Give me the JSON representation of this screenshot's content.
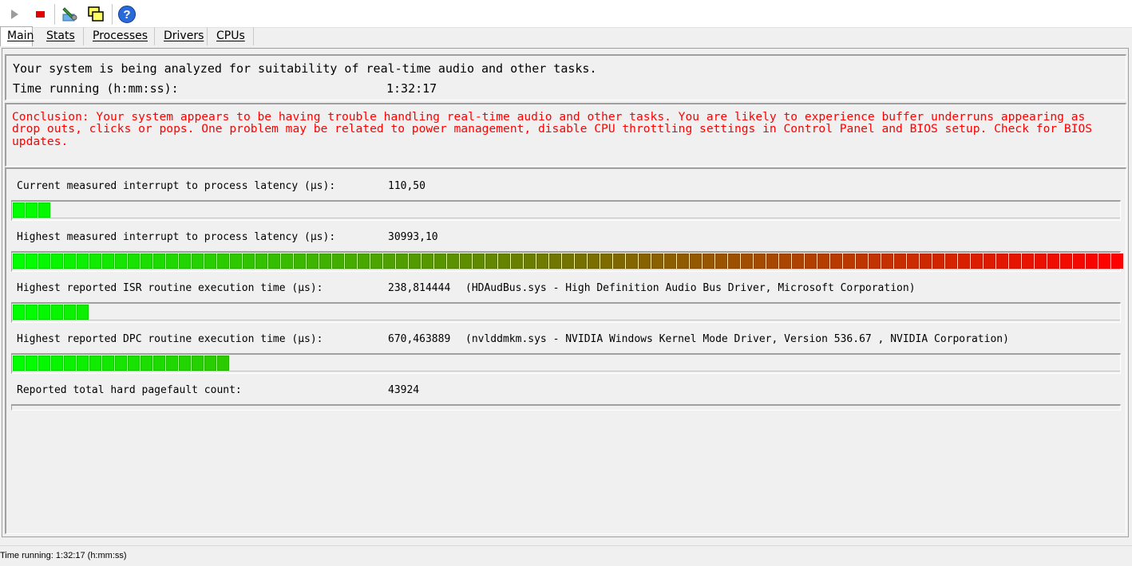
{
  "toolbar": {
    "buttons": [
      "play-icon",
      "stop-icon",
      "wrench-icon",
      "windows-icon",
      "help-icon"
    ]
  },
  "tabs": [
    {
      "label": "Main",
      "active": true
    },
    {
      "label": "Stats",
      "active": false
    },
    {
      "label": "Processes",
      "active": false
    },
    {
      "label": "Drivers",
      "active": false
    },
    {
      "label": "CPUs",
      "active": false
    }
  ],
  "summary": {
    "analyzing_text": "Your system is being analyzed for suitability of real-time audio and other tasks.",
    "time_running_label": "Time running (h:mm:ss):",
    "time_running_value": "1:32:17"
  },
  "conclusion": {
    "text": "Conclusion: Your system appears to be having trouble handling real-time audio and other tasks. You are likely to experience buffer underruns appearing as drop outs, clicks or pops. One problem may be related to power management, disable CPU throttling settings in Control Panel and BIOS setup. Check for BIOS updates.",
    "color": "#ff0000"
  },
  "metrics": [
    {
      "label": "Current measured interrupt to process latency (µs):",
      "value": "110,50",
      "detail": "",
      "bar_fraction": 0.033
    },
    {
      "label": "Highest measured interrupt to process latency (µs):",
      "value": "30993,10",
      "detail": "",
      "bar_fraction": 1.0
    },
    {
      "label": "Highest reported ISR routine execution time (µs):",
      "value": "238,814444",
      "detail": "(HDAudBus.sys - High Definition Audio Bus Driver, Microsoft Corporation)",
      "bar_fraction": 0.068
    },
    {
      "label": "Highest reported DPC routine execution time (µs):",
      "value": "670,463889",
      "detail": "(nvlddmkm.sys - NVIDIA Windows Kernel Mode Driver, Version 536.67 , NVIDIA Corporation)",
      "bar_fraction": 0.195
    },
    {
      "label": "Reported total hard pagefault count:",
      "value": "43924",
      "detail": ""
    }
  ],
  "colors": {
    "bar_green": "#00ff00",
    "bar_red": "#ff0000"
  },
  "statusbar": {
    "text": "Time running: 1:32:17  (h:mm:ss)"
  }
}
